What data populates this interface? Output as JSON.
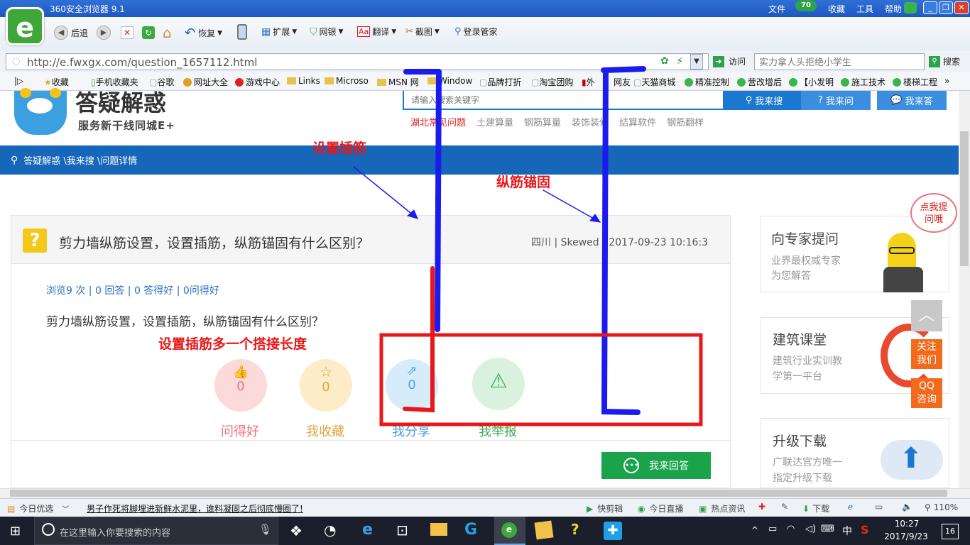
{
  "browser": {
    "title": "360安全浏览器 9.1",
    "menu": [
      "文件",
      "收藏",
      "工具",
      "帮助"
    ],
    "badge": "70",
    "logo_letter": "e",
    "toolbar": {
      "back": "后退",
      "restore": "恢复",
      "ext": "扩展",
      "bank": "网银",
      "translate": "翻译",
      "screenshot": "截图",
      "login": "登录管家"
    },
    "url": "http://e.fwxgx.com/question_1657112.html",
    "visit": "访问",
    "search_placeholder": "实力拿人头拒绝小学生",
    "search_btn": "搜索",
    "bookmarks": [
      "收藏",
      "手机收藏夹",
      "谷歌",
      "网址大全",
      "游戏中心",
      "Links",
      "Microso",
      "MSN 网",
      "Window",
      "品牌打折",
      "淘宝团购",
      "外",
      "网友",
      "天猫商城",
      "精准控制",
      "营改增后",
      "【小发明",
      "施工技术",
      "楼梯工程"
    ],
    "bookmark_more": "»"
  },
  "site": {
    "logo_title": "答疑解惑",
    "logo_sub": "服务新干线同城E+",
    "search_placeholder": "请输入搜索关键字",
    "btn_search": "我来搜",
    "btn_ask": "我来问",
    "btn_answer": "我来答",
    "tags": [
      "湖北常见问题",
      "土建算量",
      "钢筋算量",
      "装饰装修",
      "结算软件",
      "钢筋翻样"
    ],
    "breadcrumb": "答疑解惑 \\我来搜 \\问题详情"
  },
  "question": {
    "title": "剪力墙纵筋设置，设置插筋，纵筋锚固有什么区别？",
    "meta": "四川 |  Skewed | 2017-09-23 10:16:3",
    "stats": "浏览9 次 | 0 回答 | 0 答得好 | 0问得好",
    "body": "剪力墙纵筋设置，设置插筋，纵筋锚固有什么区别？",
    "actions": [
      {
        "label": "问得好",
        "count": "0",
        "icon": "thumbs-up-icon"
      },
      {
        "label": "我收藏",
        "count": "0",
        "icon": "star-icon"
      },
      {
        "label": "我分享",
        "count": "0",
        "icon": "share-icon"
      },
      {
        "label": "我举报",
        "icon": "warning-icon"
      }
    ],
    "answer_btn": "我来回答"
  },
  "annotations": {
    "insert_bar": "设置插筋",
    "anchor": "纵筋锚固",
    "note": "设置插筋多一个搭接长度"
  },
  "sidebar": {
    "expert_title": "向专家提问",
    "expert_desc1": "业界最权威专家",
    "expert_desc2": "为您解答",
    "bubble": "点我提问哦",
    "course_title": "建筑课堂",
    "course_desc1": "建筑行业实训教",
    "course_desc2": "学第一平台",
    "upgrade_title": "升级下载",
    "upgrade_desc1": "广联达官方唯一",
    "upgrade_desc2": "指定升级下载",
    "follow": "关注我们",
    "qq": "QQ咨询"
  },
  "statusbar": {
    "today": "今日优选",
    "news": "男子作死将脚埋进新鲜水泥里，谁料凝固之后彻底懵圈了!",
    "items": [
      "快剪辑",
      "今日直播",
      "热点资讯",
      "下载"
    ],
    "zoom": "110%"
  },
  "taskbar": {
    "search": "在这里输入你要搜索的内容",
    "ime": "中",
    "time": "10:27",
    "date": "2017/9/23",
    "notif": "16"
  },
  "colors": {
    "brand_blue": "#1666ba",
    "answer_green": "#1aa34a",
    "annot_red": "#e8181a",
    "annot_blue": "#1b1bef"
  }
}
